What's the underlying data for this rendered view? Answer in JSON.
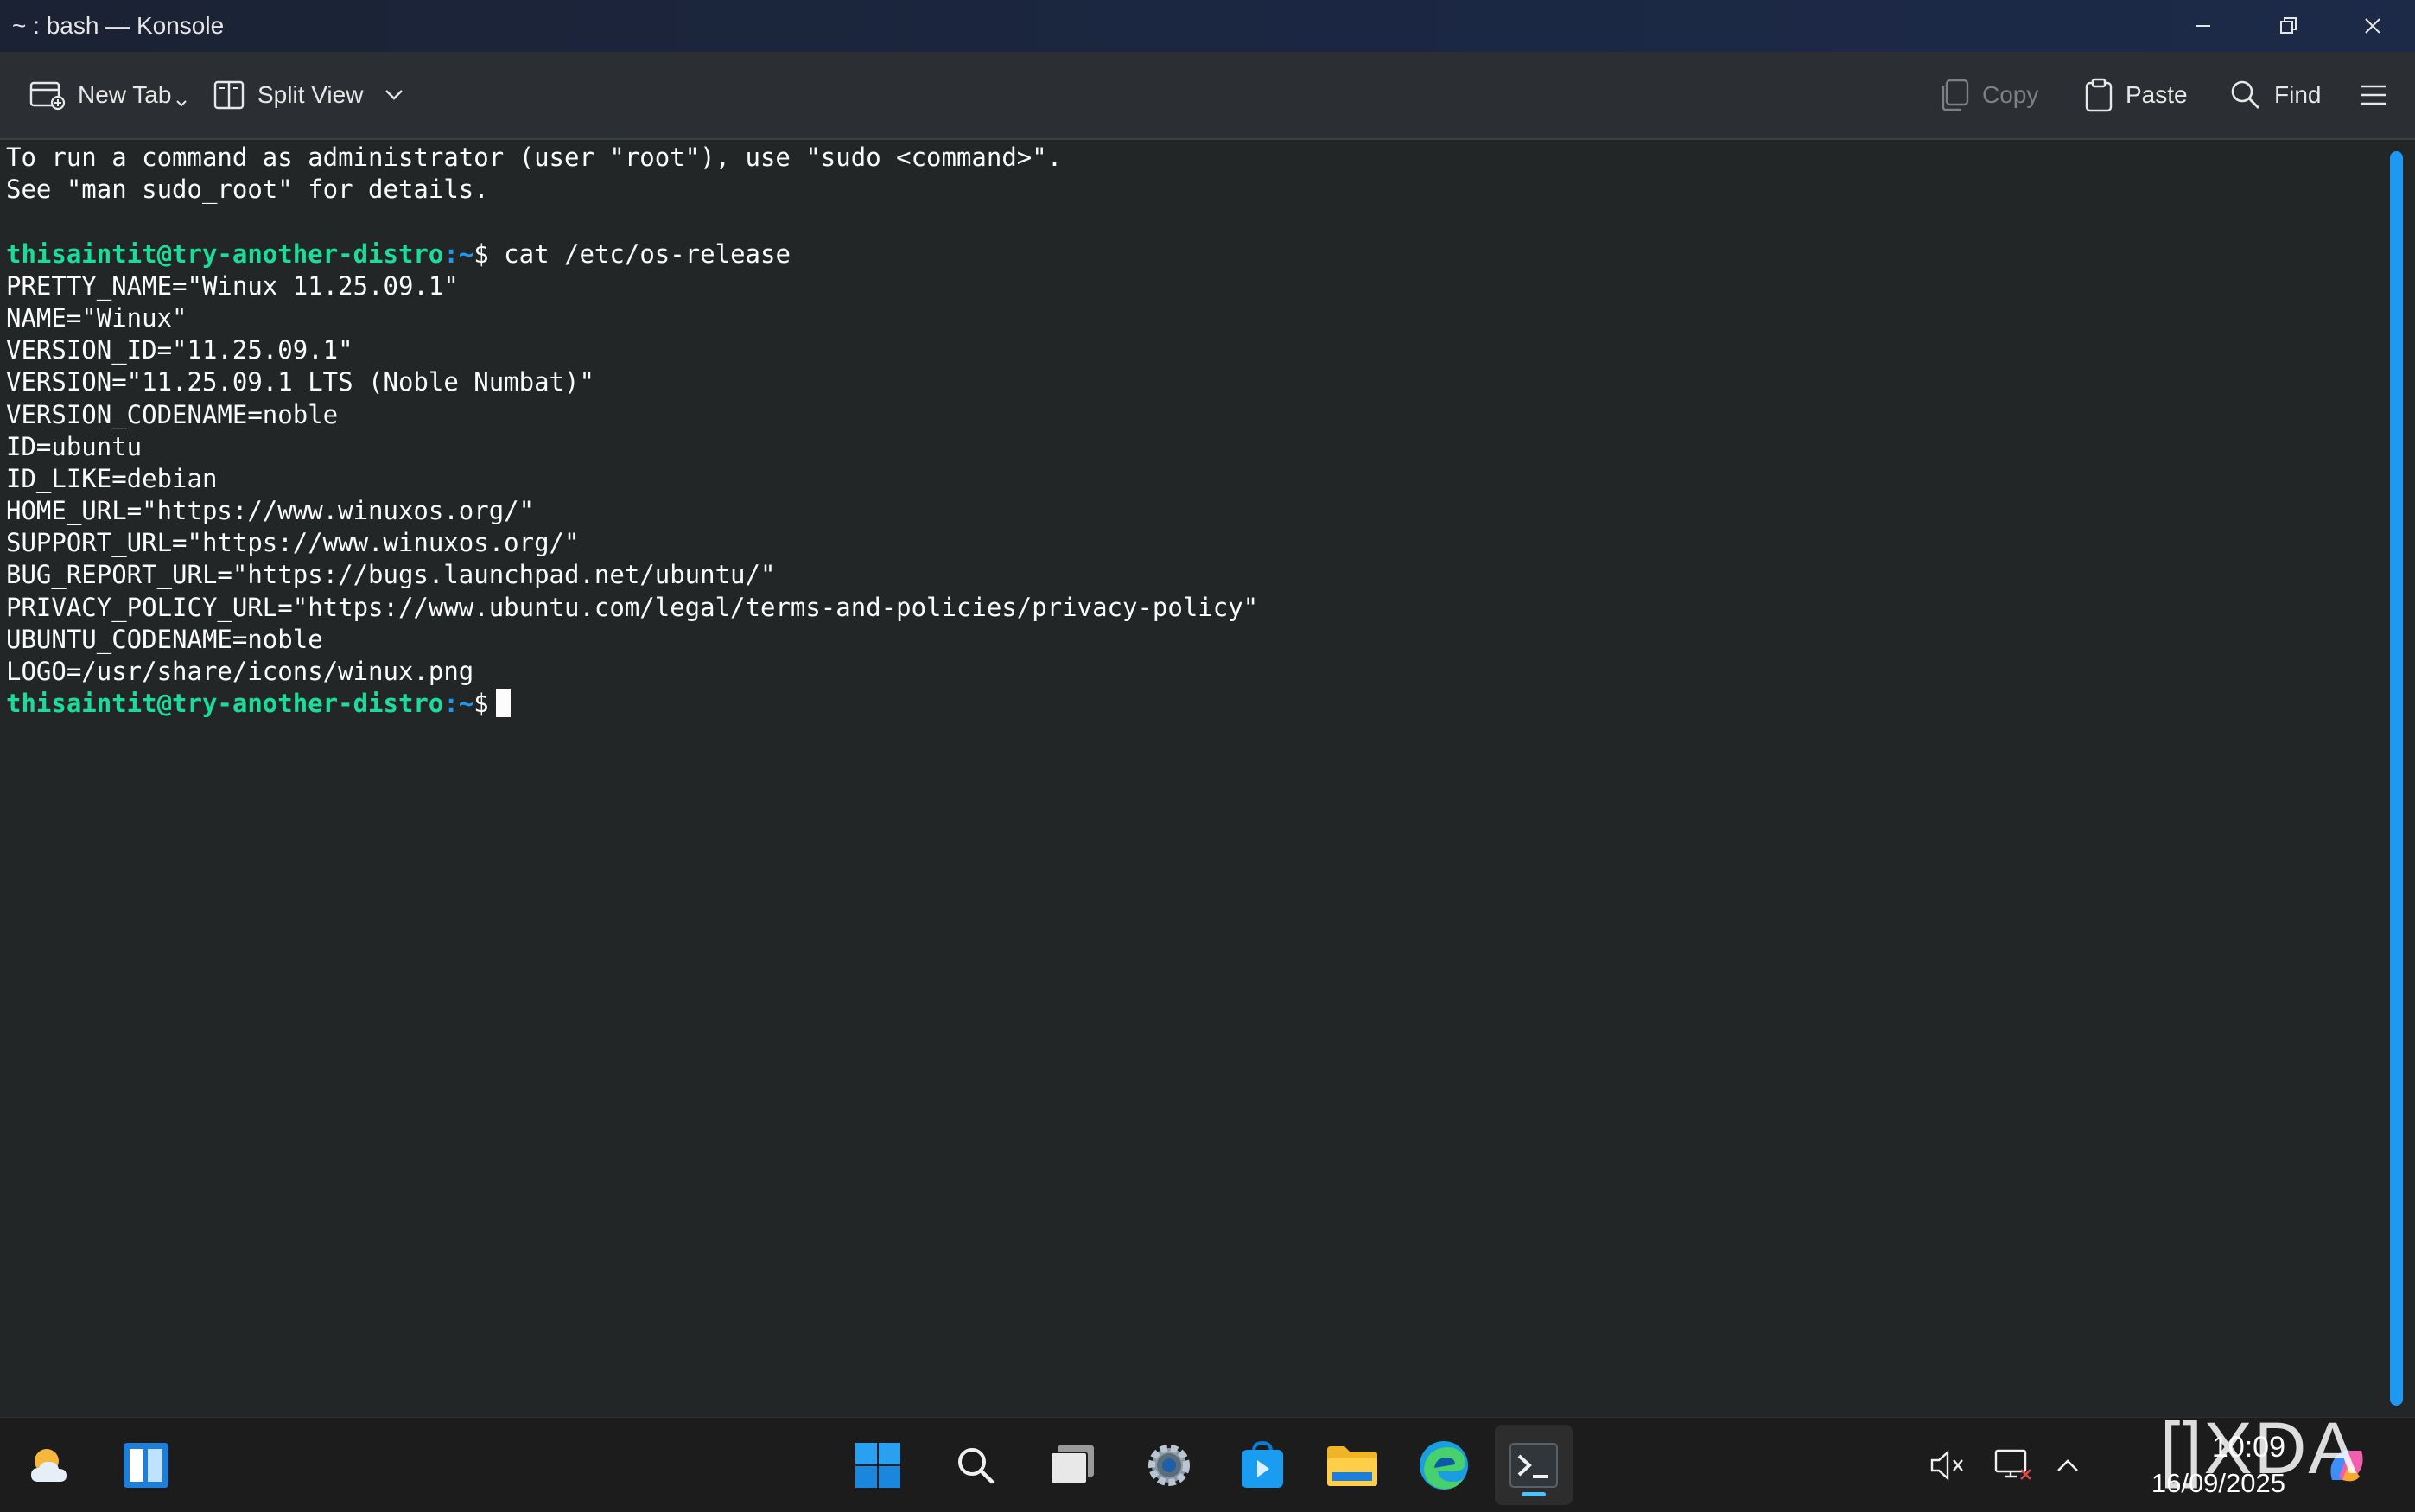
{
  "window": {
    "title": "~ : bash — Konsole"
  },
  "toolbar": {
    "new_tab": "New Tab",
    "split_view": "Split View",
    "copy": "Copy",
    "paste": "Paste",
    "find": "Find"
  },
  "terminal": {
    "prompt_user": "thisaintit@try-another-distro",
    "prompt_path": ":~",
    "prompt_symbol": "$",
    "lines": [
      "To run a command as administrator (user \"root\"), use \"sudo <command>\".",
      "See \"man sudo_root\" for details.",
      "",
      "",
      "PRETTY_NAME=\"Winux 11.25.09.1\"",
      "NAME=\"Winux\"",
      "VERSION_ID=\"11.25.09.1\"",
      "VERSION=\"11.25.09.1 LTS (Noble Numbat)\"",
      "VERSION_CODENAME=noble",
      "ID=ubuntu",
      "ID_LIKE=debian",
      "HOME_URL=\"https://www.winuxos.org/\"",
      "SUPPORT_URL=\"https://www.winuxos.org/\"",
      "BUG_REPORT_URL=\"https://bugs.launchpad.net/ubuntu/\"",
      "PRIVACY_POLICY_URL=\"https://www.ubuntu.com/legal/terms-and-policies/privacy-policy\"",
      "UBUNTU_CODENAME=noble",
      "LOGO=/usr/share/icons/winux.png"
    ],
    "command": " cat /etc/os-release"
  },
  "taskbar": {
    "time": "10:09",
    "date": "16/09/2025"
  },
  "watermark": "[]XDA",
  "colors": {
    "prompt_user": "#1cdc9a",
    "prompt_path": "#1d99f3",
    "scrollbar": "#1d99f3",
    "accent": "#4cc2ff"
  }
}
